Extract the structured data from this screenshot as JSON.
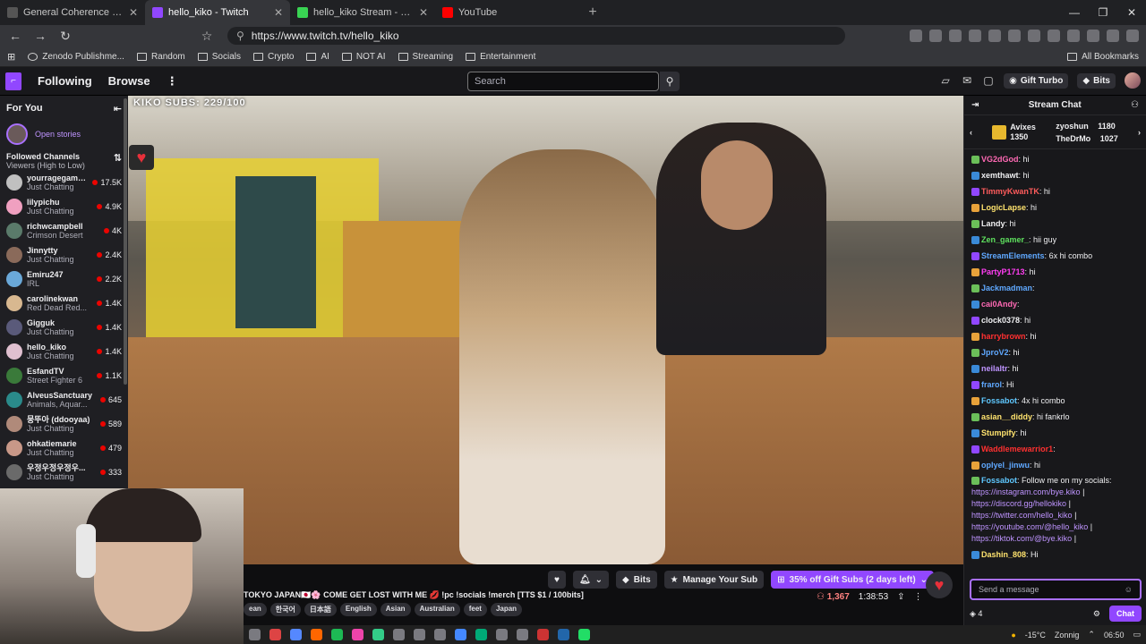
{
  "browser": {
    "tabs": [
      {
        "title": "General Coherence Field Theory (GC",
        "color": "#555555",
        "active": false
      },
      {
        "title": "hello_kiko - Twitch",
        "color": "#9147ff",
        "active": true
      },
      {
        "title": "hello_kiko Stream - Watch Live or",
        "color": "#39d353",
        "active": false
      },
      {
        "title": "YouTube",
        "color": "#ff0000",
        "active": false
      }
    ],
    "url": "https://www.twitch.tv/hello_kiko",
    "bookmarks": [
      "Zenodo Publishme...",
      "Random",
      "Socials",
      "Crypto",
      "AI",
      "NOT AI",
      "Streaming",
      "Entertainment"
    ],
    "all_bookmarks": "All Bookmarks"
  },
  "twitch": {
    "nav": {
      "following": "Following",
      "browse": "Browse",
      "search_placeholder": "Search",
      "gift_turbo": "Gift Turbo",
      "bits": "Bits"
    },
    "sidebar": {
      "for_you": "For You",
      "open_stories": "Open stories",
      "followed_title": "Followed Channels",
      "followed_sort": "Viewers (High to Low)",
      "channels": [
        {
          "name": "yourragegaming",
          "game": "Just Chatting",
          "viewers": "17.5K",
          "color": "#c0c0c0"
        },
        {
          "name": "lilypichu",
          "game": "Just Chatting",
          "viewers": "4.9K",
          "color": "#f0a0c0"
        },
        {
          "name": "richwcampbell",
          "game": "Crimson Desert",
          "viewers": "4K",
          "color": "#5a7a6a"
        },
        {
          "name": "Jinnytty",
          "game": "Just Chatting",
          "viewers": "2.4K",
          "color": "#8a6a5a"
        },
        {
          "name": "Emiru247",
          "game": "IRL",
          "viewers": "2.2K",
          "color": "#6aa8d8"
        },
        {
          "name": "carolinekwan",
          "game": "Red Dead Red...",
          "viewers": "1.4K",
          "color": "#d8b890"
        },
        {
          "name": "Gigguk",
          "game": "Just Chatting",
          "viewers": "1.4K",
          "color": "#5a5a7a"
        },
        {
          "name": "hello_kiko",
          "game": "Just Chatting",
          "viewers": "1.4K",
          "color": "#e0c0d0"
        },
        {
          "name": "EsfandTV",
          "game": "Street Fighter 6",
          "viewers": "1.1K",
          "color": "#3a7a3a"
        },
        {
          "name": "AlveusSanctuary",
          "game": "Animals, Aquar...",
          "viewers": "645",
          "color": "#2a8a8a"
        },
        {
          "name": "뭉뚜아 (ddooyaa)",
          "game": "Just Chatting",
          "viewers": "589",
          "color": "#b08a7a"
        },
        {
          "name": "ohkatiemarie",
          "game": "Just Chatting",
          "viewers": "479",
          "color": "#c89888"
        },
        {
          "name": "우정우정우정우...",
          "game": "Just Chatting",
          "viewers": "333",
          "color": "#6a6a6a"
        }
      ]
    },
    "video": {
      "sub_counter": "KIKO SUBS: 229/100"
    },
    "info": {
      "bits": "Bits",
      "manage_sub": "Manage Your Sub",
      "gift_subs": "35% off Gift Subs (2 days left)",
      "title": "TOKYO JAPAN🇯🇵🌸 COME GET LOST WITH ME 💋 !pc !socials !merch [TTS $1 / 100bits]",
      "tags": [
        "ean",
        "한국어",
        "日本語",
        "English",
        "Asian",
        "Australian",
        "feet",
        "Japan"
      ],
      "viewers": "1,367",
      "uptime": "1:38:53"
    },
    "chat": {
      "header": "Stream Chat",
      "leaderboard": [
        {
          "name": "Avixes",
          "score": "1350"
        },
        {
          "name": "zyoshun",
          "score": "1180"
        },
        {
          "name": "TheDrMo",
          "score": "1027"
        }
      ],
      "messages": [
        {
          "user": "VG2dGod",
          "text": "hi",
          "color": "#ff69b4"
        },
        {
          "user": "xemthawt",
          "text": "hi",
          "color": "#efeff1"
        },
        {
          "user": "TimmyKwanTK",
          "text": "hi",
          "color": "#ff5c5c"
        },
        {
          "user": "LogicLapse",
          "text": "hi",
          "color": "#ffe36e"
        },
        {
          "user": "Landy",
          "text": "hi",
          "color": "#efeff1"
        },
        {
          "user": "Zen_gamer_",
          "text": "hii guy",
          "color": "#5ee05e"
        },
        {
          "user": "StreamElements",
          "text": "6x hi combo",
          "color": "#5fa8ff"
        },
        {
          "user": "PartyP1713",
          "text": "hi",
          "color": "#ff3df2"
        },
        {
          "user": "Jackmadman",
          "text": "",
          "color": "#5fa8ff"
        },
        {
          "user": "cai0Andy",
          "text": "",
          "color": "#ff69b4"
        },
        {
          "user": "clock0378",
          "text": "hi",
          "color": "#efeff1"
        },
        {
          "user": "harrybrown",
          "text": "hi",
          "color": "#ff3030"
        },
        {
          "user": "JproV2",
          "text": "hi",
          "color": "#5fa8ff"
        },
        {
          "user": "neilaltr",
          "text": "hi",
          "color": "#bf94ff"
        },
        {
          "user": "frarol",
          "text": "Hi",
          "color": "#5fa8ff"
        },
        {
          "user": "Fossabot",
          "text": "4x hi combo",
          "color": "#5fc8ff"
        },
        {
          "user": "asian__diddy",
          "text": "hi fankrlo",
          "color": "#ffe36e"
        },
        {
          "user": "Stumpify",
          "text": "hi",
          "color": "#ffe36e"
        },
        {
          "user": "Waddlemewarrior1",
          "text": "",
          "color": "#ff3030"
        },
        {
          "user": "oplyel_jinwu",
          "text": "hi",
          "color": "#5fa8ff"
        }
      ],
      "fossabot_msg": {
        "user": "Fossabot",
        "text": "Follow me on my socials:",
        "links": [
          "https://instagram.com/bye.kiko",
          "https://discord.gg/hellokiko",
          "https://twitter.com/hello_kiko",
          "https://youtube.com/@hello_kiko",
          "https://tiktok.com/@bye.kiko"
        ]
      },
      "last_msg": {
        "user": "Dashin_808",
        "text": "Hi"
      },
      "input_placeholder": "Send a message",
      "points": "4",
      "chat_button": "Chat"
    }
  },
  "taskbar": {
    "temp": "-15°C",
    "weather": "Zonnig",
    "time": "06:50"
  }
}
